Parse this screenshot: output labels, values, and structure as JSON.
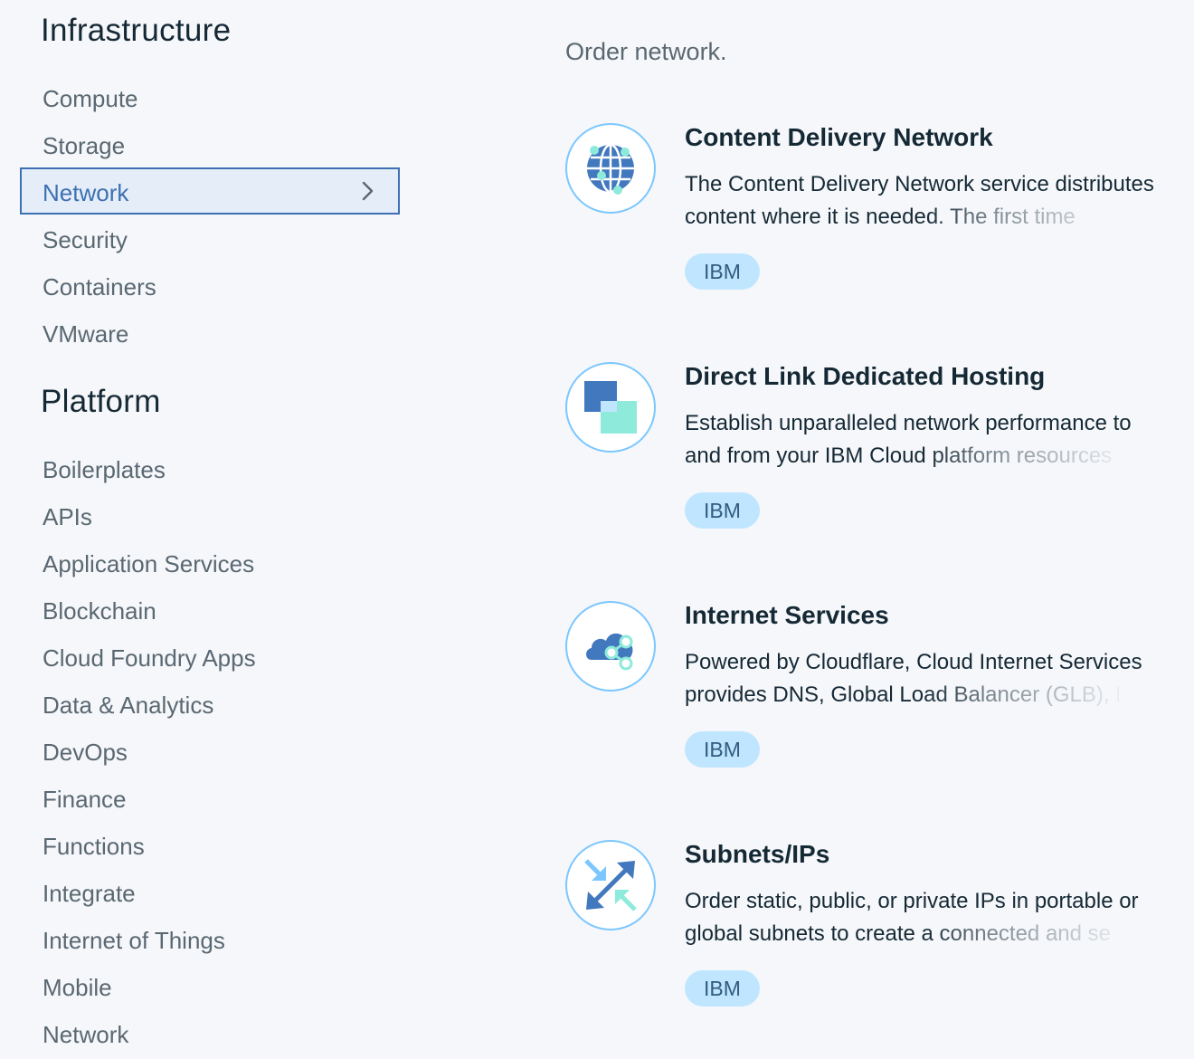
{
  "sidebar": {
    "infrastructure": {
      "title": "Infrastructure",
      "items": [
        {
          "label": "Compute"
        },
        {
          "label": "Storage"
        },
        {
          "label": "Network"
        },
        {
          "label": "Security"
        },
        {
          "label": "Containers"
        },
        {
          "label": "VMware"
        }
      ],
      "selected": "Network"
    },
    "platform": {
      "title": "Platform",
      "items": [
        {
          "label": "Boilerplates"
        },
        {
          "label": "APIs"
        },
        {
          "label": "Application Services"
        },
        {
          "label": "Blockchain"
        },
        {
          "label": "Cloud Foundry Apps"
        },
        {
          "label": "Data & Analytics"
        },
        {
          "label": "DevOps"
        },
        {
          "label": "Finance"
        },
        {
          "label": "Functions"
        },
        {
          "label": "Integrate"
        },
        {
          "label": "Internet of Things"
        },
        {
          "label": "Mobile"
        },
        {
          "label": "Network"
        }
      ]
    }
  },
  "main": {
    "heading": "Order network.",
    "cards": [
      {
        "title": "Content Delivery Network",
        "desc_line1": "The Content Delivery Network service distributes",
        "desc_line2": "content where it is needed. The first time",
        "tag": "IBM",
        "icon": "globe-icon"
      },
      {
        "title": "Direct Link Dedicated Hosting",
        "desc_line1": "Establish unparalleled network performance to",
        "desc_line2": "and from your IBM Cloud platform resources",
        "tag": "IBM",
        "icon": "direct-link-icon"
      },
      {
        "title": "Internet Services",
        "desc_line1": "Powered by Cloudflare, Cloud Internet Services",
        "desc_line2": "provides DNS, Global Load Balancer (GLB), D",
        "tag": "IBM",
        "icon": "cloud-share-icon"
      },
      {
        "title": "Subnets/IPs",
        "desc_line1": "Order static, public, or private IPs in portable or",
        "desc_line2": "global subnets to create a connected and se",
        "tag": "IBM",
        "icon": "arrows-exchange-icon"
      }
    ]
  },
  "colors": {
    "accent": "#3d70b2",
    "selected_bg": "#e4edf8",
    "tag_bg": "#c0e6ff",
    "icon_teal": "#8eeadb",
    "icon_blue": "#4178be"
  }
}
